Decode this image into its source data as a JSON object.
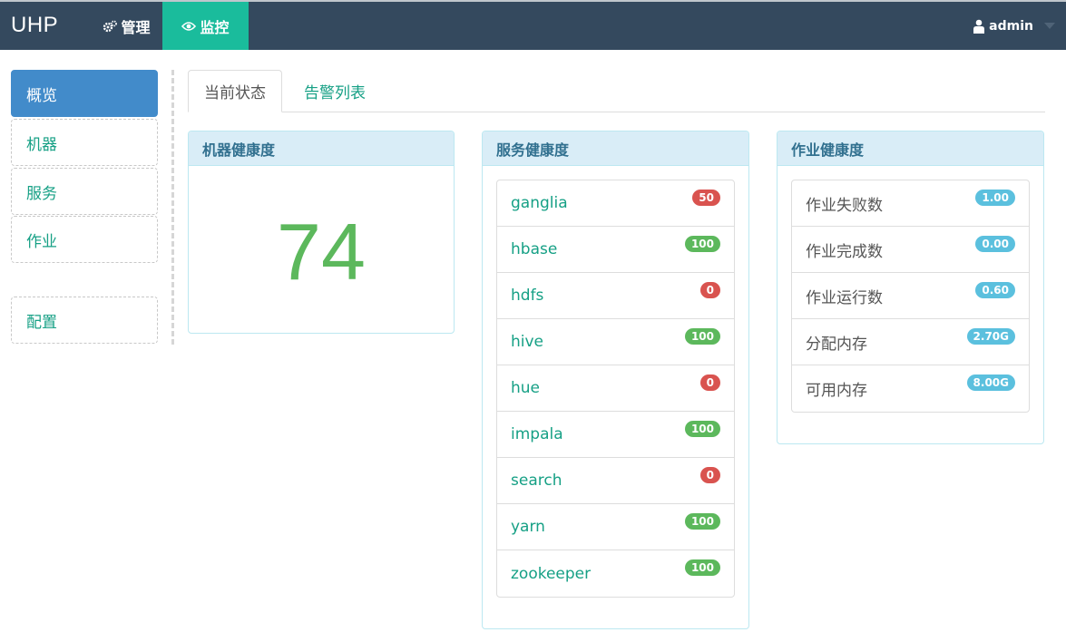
{
  "navbar": {
    "brand": "UHP",
    "manage_label": "管理",
    "monitor_label": "监控",
    "user_label": "admin"
  },
  "sidebar": {
    "items": [
      {
        "label": "概览",
        "active": true
      },
      {
        "label": "机器",
        "active": false
      },
      {
        "label": "服务",
        "active": false
      },
      {
        "label": "作业",
        "active": false
      },
      {
        "label": "配置",
        "active": false
      }
    ]
  },
  "tabs": [
    {
      "label": "当前状态",
      "active": true
    },
    {
      "label": "告警列表",
      "active": false
    }
  ],
  "machine_health": {
    "title": "机器健康度",
    "value": "74"
  },
  "service_health": {
    "title": "服务健康度",
    "items": [
      {
        "name": "ganglia",
        "badge": "50",
        "status": "red"
      },
      {
        "name": "hbase",
        "badge": "100",
        "status": "green"
      },
      {
        "name": "hdfs",
        "badge": "0",
        "status": "red"
      },
      {
        "name": "hive",
        "badge": "100",
        "status": "green"
      },
      {
        "name": "hue",
        "badge": "0",
        "status": "red"
      },
      {
        "name": "impala",
        "badge": "100",
        "status": "green"
      },
      {
        "name": "search",
        "badge": "0",
        "status": "red"
      },
      {
        "name": "yarn",
        "badge": "100",
        "status": "green"
      },
      {
        "name": "zookeeper",
        "badge": "100",
        "status": "green"
      }
    ]
  },
  "job_health": {
    "title": "作业健康度",
    "items": [
      {
        "name": "作业失败数",
        "badge": "1.00"
      },
      {
        "name": "作业完成数",
        "badge": "0.00"
      },
      {
        "name": "作业运行数",
        "badge": "0.60"
      },
      {
        "name": "分配内存",
        "badge": "2.70G"
      },
      {
        "name": "可用内存",
        "badge": "8.00G"
      }
    ]
  },
  "colors": {
    "navbar": "#34495e",
    "active_nav": "#1abc9c",
    "sidebar_active": "#428bca",
    "link": "#16a085",
    "badge_red": "#d9534f",
    "badge_green": "#5cb85c",
    "badge_blue": "#5bc0de"
  },
  "icons": {
    "manage": "gears-icon",
    "monitor": "eye-icon",
    "user": "user-icon"
  }
}
